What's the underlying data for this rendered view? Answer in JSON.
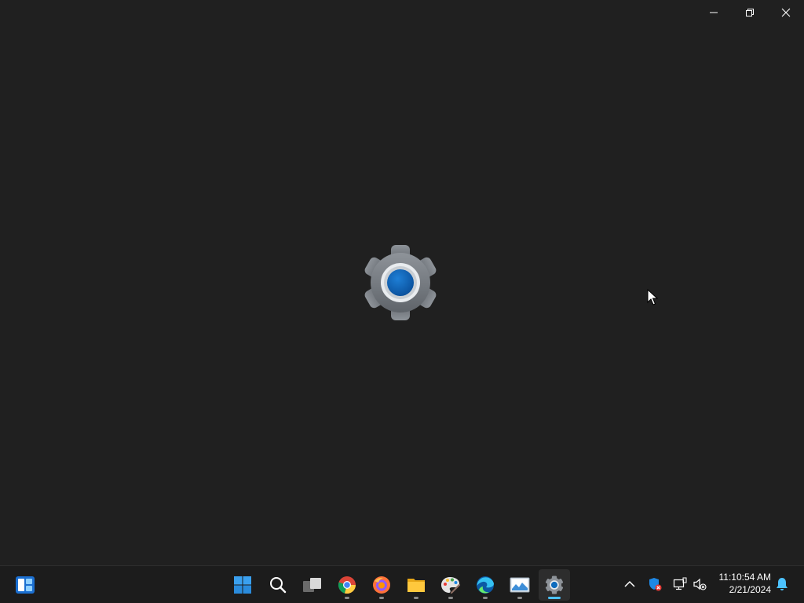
{
  "window": {
    "caption_buttons": [
      "minimize-icon",
      "restore-icon",
      "close-icon"
    ]
  },
  "splash": {
    "icon": "settings-gear-icon",
    "accent_color": "#0f6cbd"
  },
  "taskbar": {
    "widgets_icon": "widgets-icon",
    "pinned": [
      {
        "name": "start-button",
        "icon": "windows-logo-icon",
        "running": false
      },
      {
        "name": "search-button",
        "icon": "search-icon",
        "running": false
      },
      {
        "name": "task-view-button",
        "icon": "task-view-icon",
        "running": false
      },
      {
        "name": "app-button-chrome",
        "icon": "chrome-icon",
        "running": true
      },
      {
        "name": "app-button-firefox",
        "icon": "firefox-icon",
        "running": true
      },
      {
        "name": "app-button-file-explorer",
        "icon": "folder-icon",
        "running": true
      },
      {
        "name": "app-button-paint",
        "icon": "paint-palette-icon",
        "running": true
      },
      {
        "name": "app-button-edge",
        "icon": "edge-icon",
        "running": true
      },
      {
        "name": "app-button-photos",
        "icon": "photos-icon",
        "running": true
      },
      {
        "name": "app-button-settings",
        "icon": "settings-gear-icon",
        "running": true,
        "active": true
      }
    ],
    "tray": {
      "icons": [
        "chevron-up-icon",
        "security-shield-icon",
        "network-icon",
        "volume-muted-icon"
      ],
      "time": "11:10:54 AM",
      "date": "2/21/2024",
      "notification_icon": "bell-icon"
    },
    "accent_color": "#4cc2ff"
  }
}
